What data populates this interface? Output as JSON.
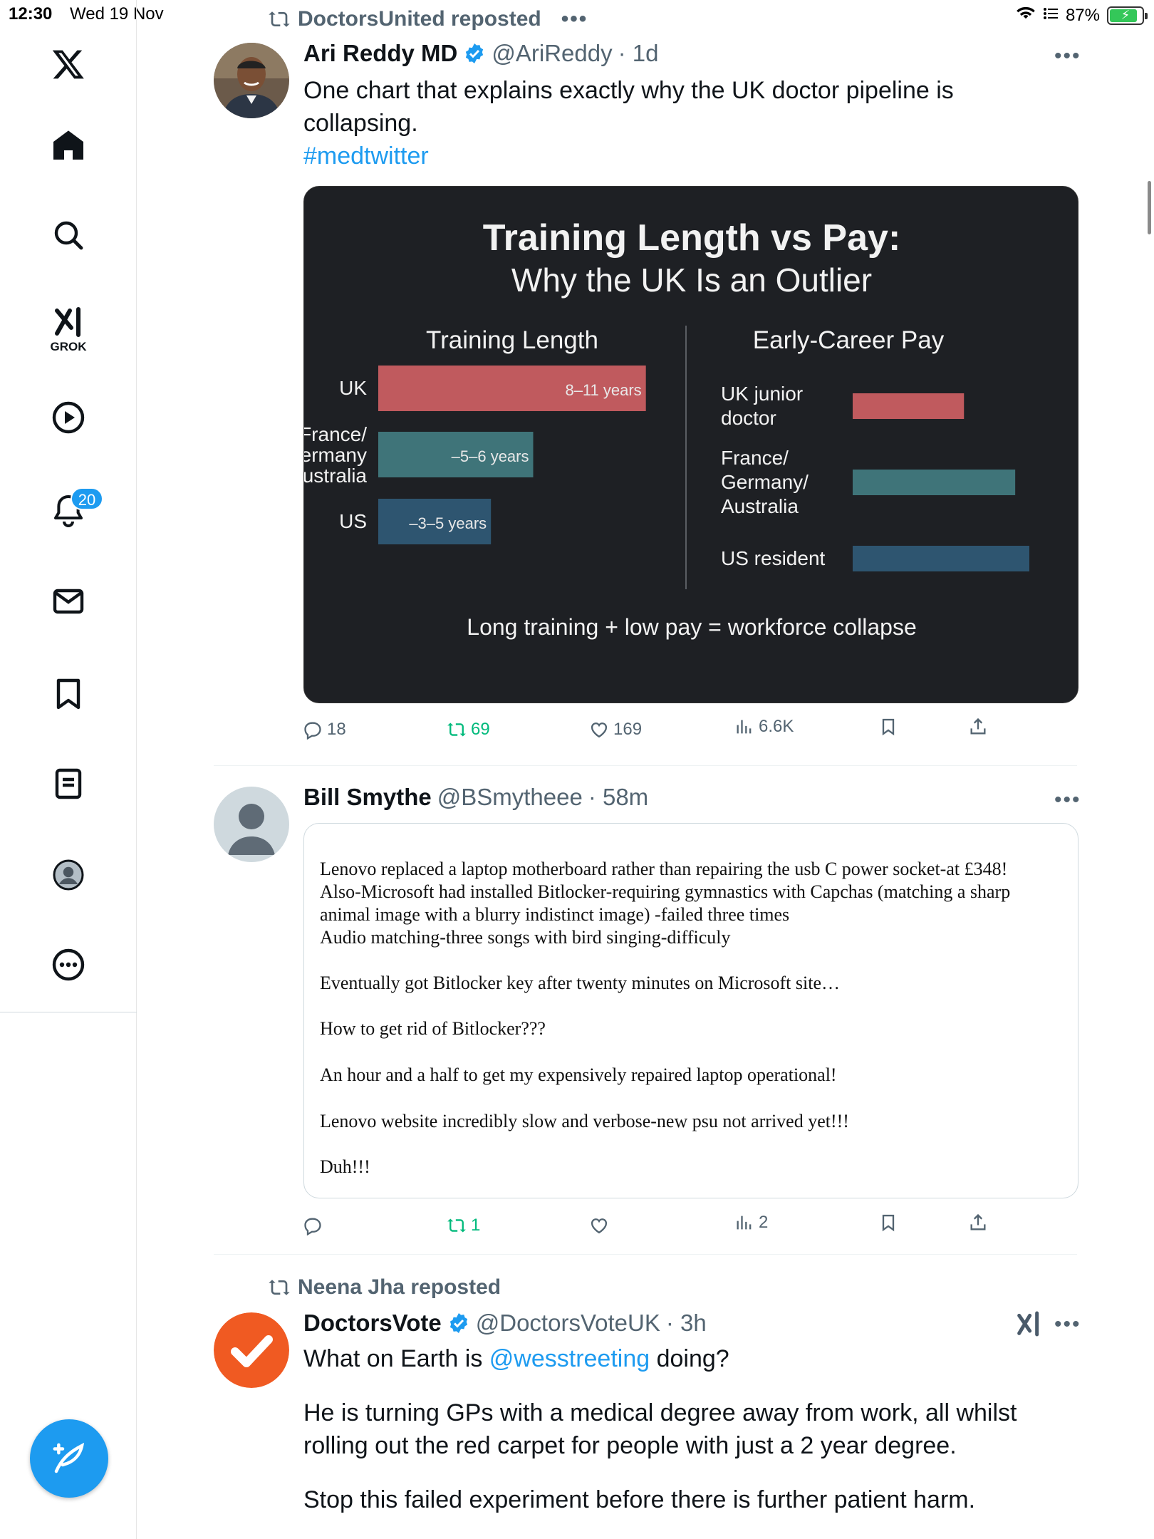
{
  "status_bar": {
    "time": "12:30",
    "date": "Wed 19 Nov",
    "battery_percent": "87%"
  },
  "sidebar": {
    "grok_label": "GROK",
    "notifications_badge": "20",
    "brand_color": "#1d9bf0"
  },
  "tweets": [
    {
      "repost_by": "DoctorsUnited reposted",
      "name": "Ari Reddy MD",
      "handle": "@AriReddy",
      "time": "· 1d",
      "text_line1": "One chart that explains exactly why the UK doctor pipeline is",
      "text_line2": "collapsing.",
      "hashtag": "#medtwitter",
      "replies": "18",
      "reposts": "69",
      "likes": "169",
      "views": "6.6K"
    },
    {
      "name": "Bill Smythe",
      "handle": "@BSmytheee",
      "time": "· 58m",
      "replies": "",
      "reposts": "1",
      "likes": "",
      "views": "2"
    },
    {
      "repost_by": "Neena Jha reposted",
      "name": "DoctorsVote",
      "handle": "@DoctorsVoteUK",
      "time": "· 3h",
      "text_pre": "What on Earth is ",
      "mention": "@wesstreeting",
      "text_post": " doing?",
      "para2_line1": "He is turning GPs with a medical degree away from work, all whilst",
      "para2_line2": "rolling out the red carpet for people with just a 2 year degree.",
      "para3": "Stop this failed experiment before there is further patient harm."
    }
  ],
  "quote_card": {
    "paragraphs": [
      "Lenovo replaced a laptop motherboard rather than repairing the usb C power socket-at £348!\nAlso-Microsoft had installed Bitlocker-requiring gymnastics with Capchas (matching a sharp\nanimal image with a blurry indistinct image) -failed three times\nAudio matching-three songs with bird singing-difficuly",
      "Eventually got Bitlocker key after twenty minutes on Microsoft site…",
      "How to get rid of Bitlocker???",
      "An hour and a half to get my expensively repaired laptop operational!",
      "Lenovo website incredibly slow and verbose-new psu not arrived yet!!!",
      "Duh!!!"
    ]
  },
  "chart_data": {
    "type": "bar",
    "title": "Training Length vs Pay:",
    "subtitle": "Why the UK Is an Outlier",
    "footer": "Long training + low pay = workforce collapse",
    "panels": [
      {
        "heading": "Training Length",
        "categories": [
          "UK",
          "France/\nGermany\nAustralia",
          "US"
        ],
        "category_lines": [
          [
            "UK"
          ],
          [
            "France/",
            "Germany",
            "Australia"
          ],
          [
            "US"
          ]
        ],
        "values": [
          9.5,
          5.5,
          4
        ],
        "value_labels": [
          "8–11 years",
          "–5–6 years",
          "–3–5 years"
        ],
        "colors": [
          "#c05a5e",
          "#3f7479",
          "#2e5570"
        ],
        "xlim": [
          0,
          11
        ]
      },
      {
        "heading": "Early-Career Pay",
        "categories": [
          "UK junior doctor",
          "France/ Germany/ Australia",
          "US resident"
        ],
        "category_lines": [
          [
            "UK junior",
            "doctor"
          ],
          [
            "France/",
            "Germany/",
            "Australia"
          ],
          [
            "US resident"
          ]
        ],
        "values": [
          0.63,
          0.92,
          1.0
        ],
        "colors": [
          "#c05a5e",
          "#3f7479",
          "#2e5570"
        ],
        "xlim": [
          0,
          1
        ]
      }
    ]
  }
}
